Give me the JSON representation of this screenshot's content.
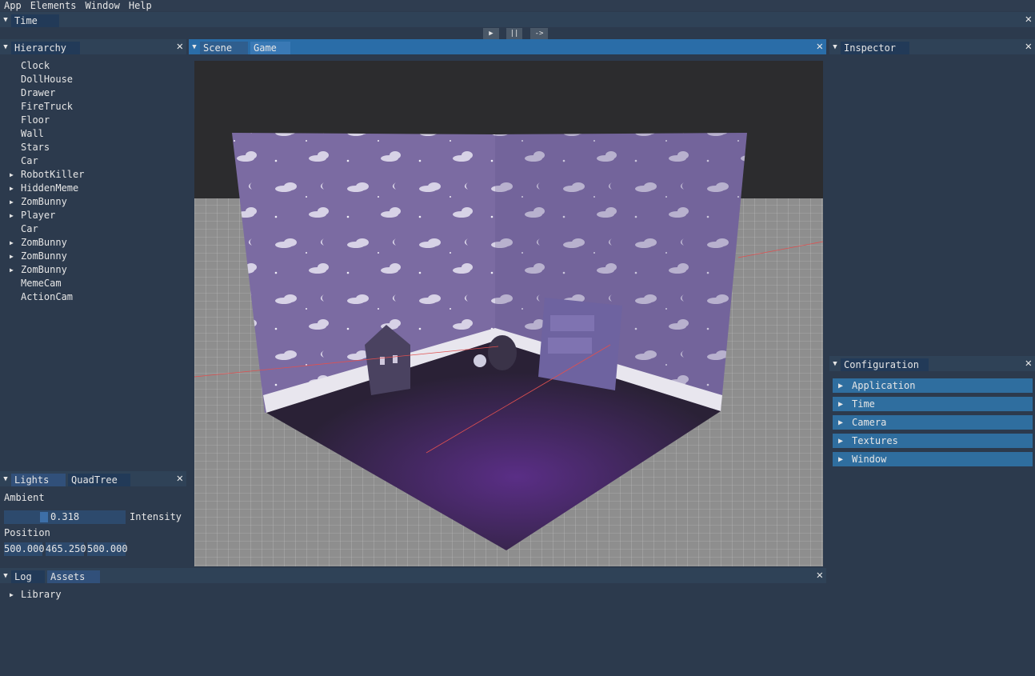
{
  "menu": [
    "App",
    "Elements",
    "Window",
    "Help"
  ],
  "time_panel": {
    "tab": "Time",
    "controls": {
      "play": "▶",
      "pause": "||",
      "step": "->"
    }
  },
  "hierarchy": {
    "tab": "Hierarchy",
    "items": [
      {
        "label": "Clock",
        "expandable": false
      },
      {
        "label": "DollHouse",
        "expandable": false
      },
      {
        "label": "Drawer",
        "expandable": false
      },
      {
        "label": "FireTruck",
        "expandable": false
      },
      {
        "label": "Floor",
        "expandable": false
      },
      {
        "label": "Wall",
        "expandable": false
      },
      {
        "label": "Stars",
        "expandable": false
      },
      {
        "label": "Car",
        "expandable": false
      },
      {
        "label": "RobotKiller",
        "expandable": true
      },
      {
        "label": "HiddenMeme",
        "expandable": true
      },
      {
        "label": "ZomBunny",
        "expandable": true
      },
      {
        "label": "Player",
        "expandable": true
      },
      {
        "label": "Car",
        "expandable": false
      },
      {
        "label": "ZomBunny",
        "expandable": true
      },
      {
        "label": "ZomBunny",
        "expandable": true
      },
      {
        "label": "ZomBunny",
        "expandable": true
      },
      {
        "label": "MemeCam",
        "expandable": false
      },
      {
        "label": "ActionCam",
        "expandable": false
      }
    ]
  },
  "scene_panel": {
    "tabs": [
      "Scene",
      "Game"
    ]
  },
  "inspector": {
    "tab": "Inspector"
  },
  "configuration": {
    "tab": "Configuration",
    "sections": [
      "Application",
      "Time",
      "Camera",
      "Textures",
      "Window"
    ]
  },
  "lights": {
    "tabs": [
      "Lights",
      "QuadTree"
    ],
    "ambient_label": "Ambient",
    "intensity_value": "0.318",
    "intensity_fraction": 0.318,
    "intensity_label": "Intensity",
    "position_label": "Position",
    "position": [
      "500.000",
      "465.250",
      "500.000"
    ]
  },
  "log": {
    "tabs": [
      "Log",
      "Assets"
    ],
    "items": [
      "Library"
    ]
  },
  "icons": {
    "collapse": "▼",
    "expand": "▶",
    "close": "✕"
  },
  "colors": {
    "background": "#2c3a4d",
    "titlebar": "#2f4257",
    "titlebar_active": "#2a6da8",
    "header": "#2f6e9f",
    "wallpaper": "#7a6aa0"
  }
}
